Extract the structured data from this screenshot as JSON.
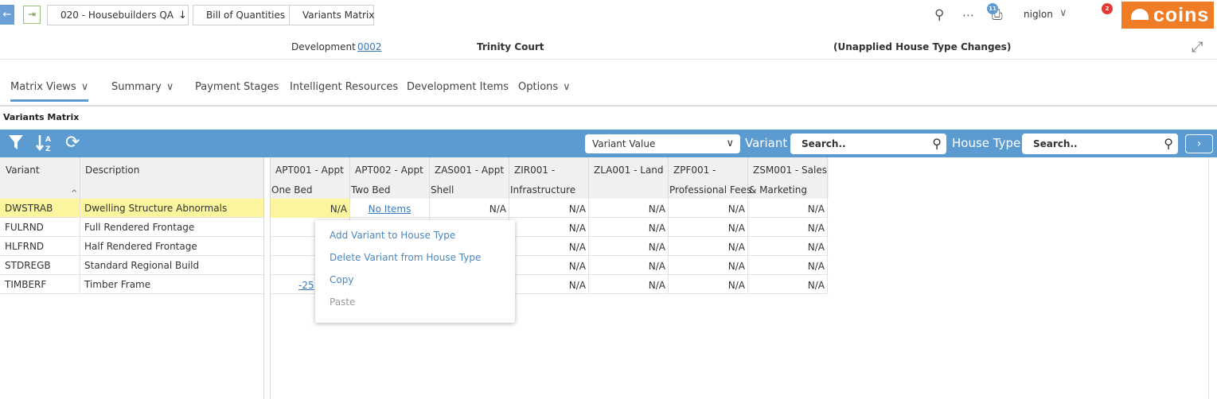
{
  "topbar": {
    "breadcrumbs": [
      "020 - Housebuilders QA",
      "Bill of Quantities",
      "Variants Matrix"
    ],
    "print_badge": "11",
    "notif_badge": "2",
    "user": "niglon",
    "logo_text": "coins"
  },
  "info": {
    "development_label": "Development",
    "development_code": "0002",
    "development_name": "Trinity Court",
    "status": "(Unapplied House Type Changes)"
  },
  "menu": {
    "items": [
      "Matrix Views",
      "Summary",
      "Payment Stages",
      "Intelligent Resources",
      "Development Items",
      "Options"
    ]
  },
  "section_title": "Variants Matrix",
  "toolbar": {
    "dropdown_value": "Variant Value",
    "variant_label": "Variant",
    "variant_search_placeholder": "Search..",
    "house_type_label": "House Type",
    "house_type_search_placeholder": "Search.."
  },
  "left_grid": {
    "headers": [
      "Variant",
      "Description"
    ],
    "rows": [
      {
        "variant": "DWSTRAB",
        "description": "Dwelling Structure Abnormals"
      },
      {
        "variant": "FULRND",
        "description": "Full Rendered Frontage"
      },
      {
        "variant": "HLFRND",
        "description": "Half Rendered Frontage"
      },
      {
        "variant": "STDREGB",
        "description": "Standard Regional Build"
      },
      {
        "variant": "TIMBERF",
        "description": "Timber Frame"
      }
    ]
  },
  "right_grid": {
    "headers": [
      {
        "line1": "APT001 - Appt",
        "line2": "One Bed"
      },
      {
        "line1": "APT002 - Appt",
        "line2": "Two Bed"
      },
      {
        "line1": "ZAS001 - Appt",
        "line2": "Shell"
      },
      {
        "line1": "ZIR001 -",
        "line2": "Infrastructure"
      },
      {
        "line1": "ZLA001 - Land",
        "line2": ""
      },
      {
        "line1": "ZPF001 -",
        "line2": "Professional Fees"
      },
      {
        "line1": "ZSM001 - Sales",
        "line2": "& Marketing"
      }
    ],
    "rows": [
      [
        "N/A",
        "No Items",
        "N/A",
        "N/A",
        "N/A",
        "N/A",
        "N/A"
      ],
      [
        "",
        "",
        "",
        "N/A",
        "N/A",
        "N/A",
        "N/A"
      ],
      [
        "",
        "",
        "",
        "N/A",
        "N/A",
        "N/A",
        "N/A"
      ],
      [
        "",
        "",
        "",
        "N/A",
        "N/A",
        "N/A",
        "N/A"
      ],
      [
        "-25",
        "",
        "",
        "N/A",
        "N/A",
        "N/A",
        "N/A"
      ]
    ]
  },
  "context_menu": {
    "items": [
      {
        "label": "Add Variant to House Type",
        "enabled": true
      },
      {
        "label": "Delete Variant from House Type",
        "enabled": true
      },
      {
        "label": "Copy",
        "enabled": true
      },
      {
        "label": "Paste",
        "enabled": false
      }
    ]
  },
  "colors": {
    "accent": "#5b9bd1",
    "brand_orange": "#f07d26",
    "selection": "#fbf59e",
    "link": "#3b7ab8"
  }
}
